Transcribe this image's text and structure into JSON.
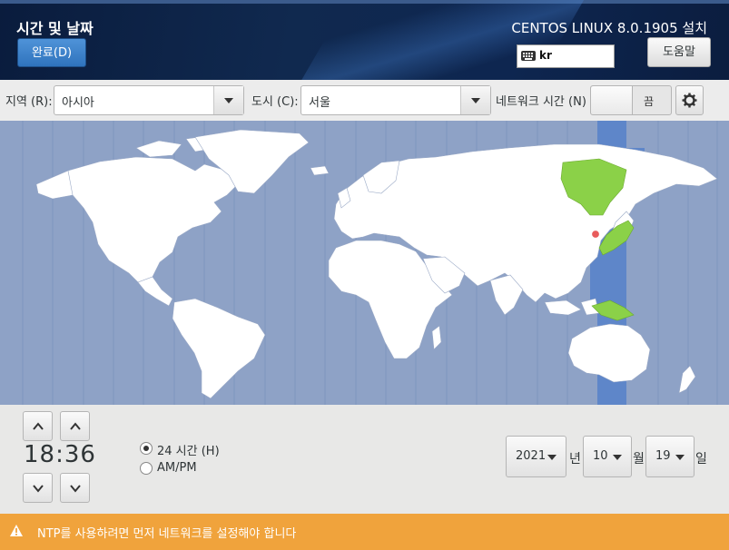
{
  "header": {
    "title": "시간 및 날짜",
    "done_button": "완료(D)",
    "product": "CENTOS LINUX 8.0.1905 설치",
    "keyboard_layout": "kr",
    "help_button": "도움말"
  },
  "selectors": {
    "region_label": "지역 (R):",
    "region_value": "아시아",
    "city_label": "도시 (C):",
    "city_value": "서울",
    "network_time_label": "네트워크 시간 (N)",
    "network_time_state": "끔"
  },
  "map": {
    "selected_timezone_highlight": "#5e86c9",
    "highlighted_country_color": "#8bd148",
    "marker_color": "#e85c5c"
  },
  "time": {
    "hours": "18",
    "separator": ":",
    "minutes": "36",
    "format_24h_label": "24 시간 (H)",
    "format_ampm_label": "AM/PM",
    "selected_format": "24h"
  },
  "date": {
    "year": "2021",
    "year_unit": "년",
    "month": "10",
    "month_unit": "월",
    "day": "19",
    "day_unit": "일"
  },
  "warning": {
    "text": "NTP를 사용하려면 먼저 네트워크를 설정해야 합니다",
    "color": "#f0a33c"
  }
}
